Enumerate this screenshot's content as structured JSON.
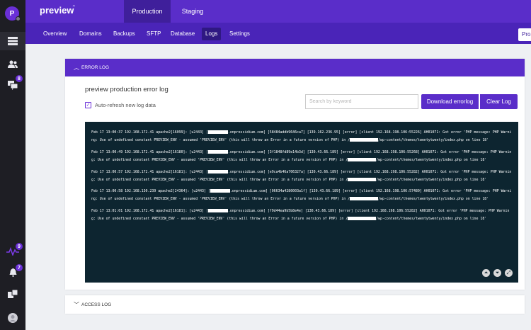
{
  "rail": {
    "avatar_initial": "P",
    "badges": {
      "users": "8",
      "activity": "9",
      "alerts": "7"
    }
  },
  "topbar": {
    "site_name": "preview",
    "site_caret": "⌃",
    "env_tabs": [
      "Production",
      "Staging"
    ]
  },
  "subnav": {
    "items": [
      "Overview",
      "Domains",
      "Backups",
      "SFTP",
      "Database",
      "Logs",
      "Settings"
    ],
    "action_label": "Pro"
  },
  "error_log": {
    "header": "ERROR LOG",
    "title": "preview production error log",
    "auto_refresh_label": "Auto-refresh new log data",
    "auto_refresh_checked": true,
    "search_placeholder": "Search by keyword",
    "download_label": "Download errorlog",
    "clear_label": "Clear Log",
    "entries": [
      {
        "pre": "Feb 17 13:00:37 192.168.172.41 apache2[16099]: [u2443] [",
        "mid": ".onpressidium.com] [58484addb9646ca7] [139.162.236.95] [error] [client 192.168.198.106:55226] AH01071: Got error 'PHP message: PHP Warning: Use of undefined constant PREVIEW_ENV - assumed 'PREVIEW_ENV' (this will throw an Error in a future version of PHP) in /",
        "post": "/wp-content/themes/twentytwenty/index.php on line 18'"
      },
      {
        "pre": "Feb 17 13:00:49 192.168.172.41 apache2[16180]: [u2443] [",
        "mid": ".onpressidium.com] [3f1848fd89e14b3d] [130.43.66.189] [error] [client 192.168.198.106:55268] AH01071: Got error 'PHP message: PHP Warning: Use of undefined constant PREVIEW_ENV - assumed 'PREVIEW_ENV' (this will throw an Error in a future version of PHP) in /",
        "post": "/wp-content/themes/twentytwenty/index.php on line 18'"
      },
      {
        "pre": "Feb 17 13:00:57 192.168.172.41 apache2[16181]: [u2443] [",
        "mid": ".onpressidium.com] [e9ca4b46a706327a] [130.43.66.189] [error] [client 192.168.198.106:55282] AH01071: Got error 'PHP message: PHP Warning: Use of undefined constant PREVIEW_ENV - assumed 'PREVIEW_ENV' (this will throw an Error in a future version of PHP) in /",
        "post": "/wp-content/themes/twentytwenty/index.php on line 18'"
      },
      {
        "pre": "Feb 17 13:00:58 192.168.130.239 apache2[24364]: [u2443] [",
        "mid": ".onpressidium.com] [06634a4280003a1f] [130.43.66.189] [error] [client 192.168.198.106:57480] AH01071: Got error 'PHP message: PHP Warning: Use of undefined constant PREVIEW_ENV - assumed 'PREVIEW_ENV' (this will throw an Error in a future version of PHP) in /",
        "post": "/wp-content/themes/twentytwenty/index.php on line 18'"
      },
      {
        "pre": "Feb 17 13:01:01 192.168.172.41 apache2[16181]: [u2443] [",
        "mid": ".onpressidium.com] [f9d44ea9b5b8e4e] [130.43.66.189] [error] [client 192.168.198.106:55282] AH01071: Got error 'PHP message: PHP Warning: Use of undefined constant PREVIEW_ENV - assumed 'PREVIEW_ENV' (this will throw an Error in a future version of PHP) in /",
        "post": "/wp-content/themes/twentytwenty/index.php on line 18'"
      }
    ],
    "controls": [
      "scroll-top",
      "scroll-bottom",
      "fullscreen"
    ]
  },
  "access_log": {
    "header": "ACCESS LOG"
  },
  "colors": {
    "brand": "#5a2dc9",
    "brand_dark": "#4a24b8",
    "console_bg": "#0d2530",
    "rail_bg": "#1e1e24"
  }
}
